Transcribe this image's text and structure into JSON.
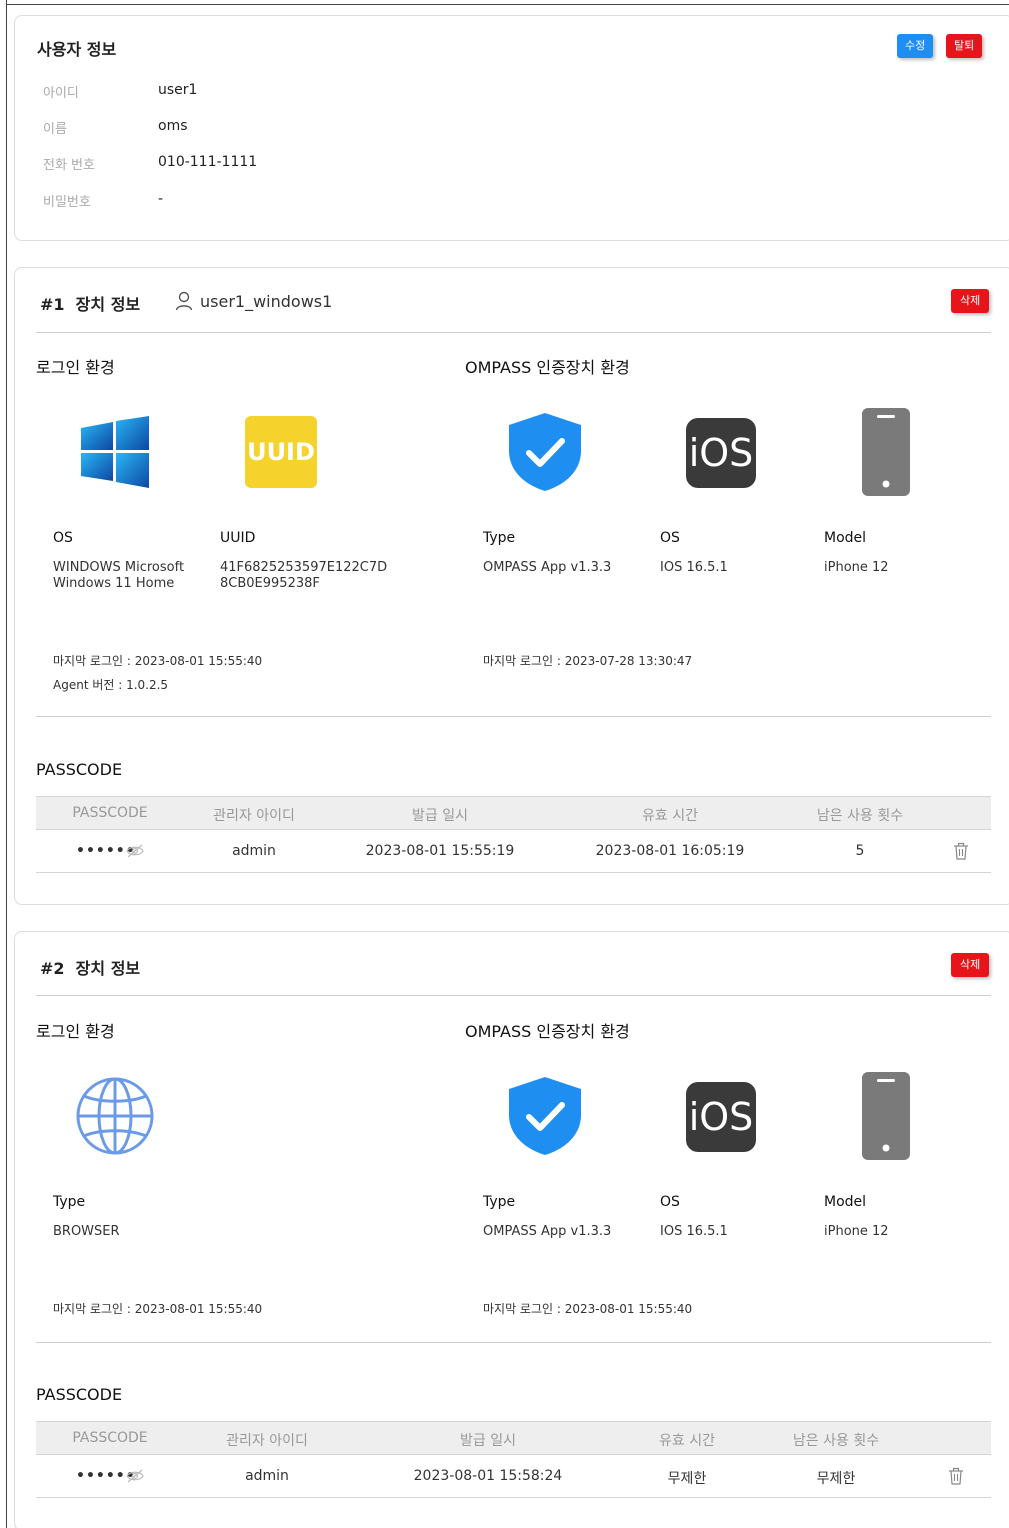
{
  "user_info": {
    "title": "사용자 정보",
    "edit_label": "수정",
    "withdraw_label": "탈퇴",
    "fields": [
      {
        "label": "아이디",
        "value": "user1"
      },
      {
        "label": "이름",
        "value": "oms"
      },
      {
        "label": "전화 번호",
        "value": "010-111-1111"
      },
      {
        "label": "비밀번호",
        "value": "-"
      }
    ]
  },
  "devices": [
    {
      "title": "#1  장치 정보",
      "username": "user1_windows1",
      "delete_label": "삭제",
      "login_env_title": "로그인 환경",
      "ompass_env_title": "OMPASS 인증장치 환경",
      "login_items": [
        {
          "label": "OS",
          "value": "WINDOWS Microsoft\nWindows 11 Home"
        },
        {
          "label": "UUID",
          "value": "41F6825253597E122C7D\n8CB0E995238F"
        }
      ],
      "uuid_tile_text": "UUID",
      "ompass_items": [
        {
          "label": "Type",
          "value": "OMPASS App v1.3.3"
        },
        {
          "label": "OS",
          "value": "IOS 16.5.1"
        },
        {
          "label": "Model",
          "value": "iPhone 12"
        }
      ],
      "ios_tile_text": "iOS",
      "login_last": "마지막 로그인 : 2023-08-01 15:55:40",
      "agent_version": "Agent 버전 : 1.0.2.5",
      "ompass_last": "마지막 로그인 : 2023-07-28 13:30:47",
      "passcode_title": "PASSCODE",
      "table": {
        "headers": [
          "PASSCODE",
          "관리자 아이디",
          "발급 일시",
          "유효 시간",
          "남은 사용 횟수"
        ],
        "row": {
          "passcode": "••••••",
          "admin": "admin",
          "issued": "2023-08-01 15:55:19",
          "valid": "2023-08-01 16:05:19",
          "remaining": "5"
        }
      }
    },
    {
      "title": "#2  장치 정보",
      "delete_label": "삭제",
      "login_env_title": "로그인 환경",
      "ompass_env_title": "OMPASS 인증장치 환경",
      "login_items": [
        {
          "label": "Type",
          "value": "BROWSER"
        }
      ],
      "ompass_items": [
        {
          "label": "Type",
          "value": "OMPASS App v1.3.3"
        },
        {
          "label": "OS",
          "value": "IOS 16.5.1"
        },
        {
          "label": "Model",
          "value": "iPhone 12"
        }
      ],
      "ios_tile_text": "iOS",
      "login_last": "마지막 로그인 : 2023-08-01 15:55:40",
      "ompass_last": "마지막 로그인 : 2023-08-01 15:55:40",
      "passcode_title": "PASSCODE",
      "table": {
        "headers": [
          "PASSCODE",
          "관리자 아이디",
          "발급 일시",
          "유효 시간",
          "남은 사용 횟수"
        ],
        "row": {
          "passcode": "••••••",
          "admin": "admin",
          "issued": "2023-08-01 15:58:24",
          "valid": "무제한",
          "remaining": "무제한"
        }
      }
    }
  ],
  "colors": {
    "primary_blue": "#1f8ef1",
    "danger_red": "#e8141c",
    "shield_blue": "#1e8ff0",
    "uuid_yellow": "#f5d22c"
  }
}
